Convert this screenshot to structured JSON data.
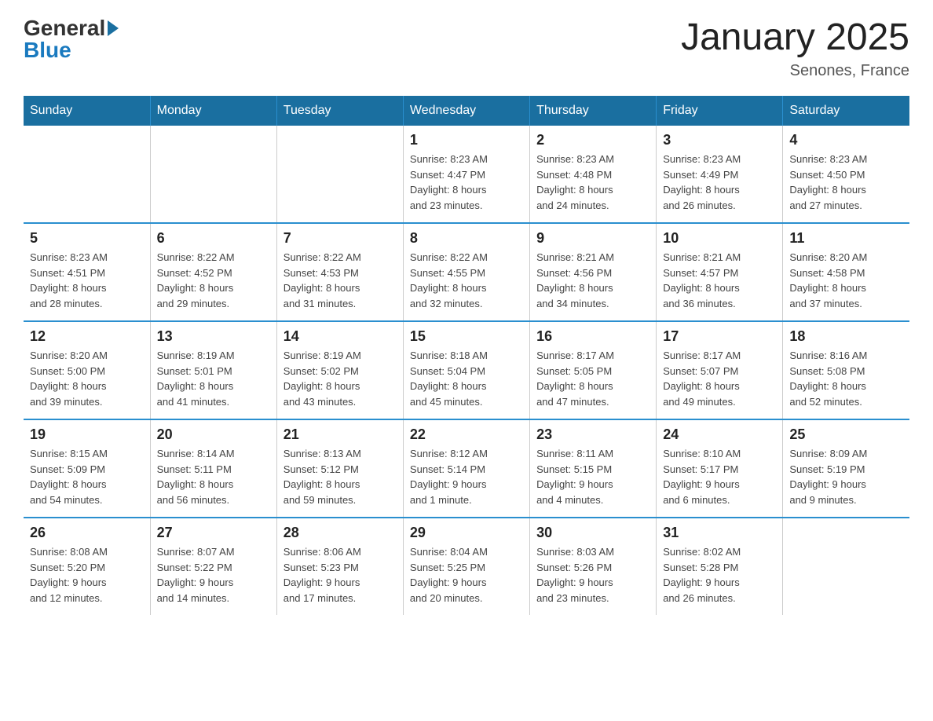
{
  "logo": {
    "general": "General",
    "blue": "Blue"
  },
  "title": "January 2025",
  "subtitle": "Senones, France",
  "weekdays": [
    "Sunday",
    "Monday",
    "Tuesday",
    "Wednesday",
    "Thursday",
    "Friday",
    "Saturday"
  ],
  "weeks": [
    [
      {
        "day": "",
        "info": ""
      },
      {
        "day": "",
        "info": ""
      },
      {
        "day": "",
        "info": ""
      },
      {
        "day": "1",
        "info": "Sunrise: 8:23 AM\nSunset: 4:47 PM\nDaylight: 8 hours\nand 23 minutes."
      },
      {
        "day": "2",
        "info": "Sunrise: 8:23 AM\nSunset: 4:48 PM\nDaylight: 8 hours\nand 24 minutes."
      },
      {
        "day": "3",
        "info": "Sunrise: 8:23 AM\nSunset: 4:49 PM\nDaylight: 8 hours\nand 26 minutes."
      },
      {
        "day": "4",
        "info": "Sunrise: 8:23 AM\nSunset: 4:50 PM\nDaylight: 8 hours\nand 27 minutes."
      }
    ],
    [
      {
        "day": "5",
        "info": "Sunrise: 8:23 AM\nSunset: 4:51 PM\nDaylight: 8 hours\nand 28 minutes."
      },
      {
        "day": "6",
        "info": "Sunrise: 8:22 AM\nSunset: 4:52 PM\nDaylight: 8 hours\nand 29 minutes."
      },
      {
        "day": "7",
        "info": "Sunrise: 8:22 AM\nSunset: 4:53 PM\nDaylight: 8 hours\nand 31 minutes."
      },
      {
        "day": "8",
        "info": "Sunrise: 8:22 AM\nSunset: 4:55 PM\nDaylight: 8 hours\nand 32 minutes."
      },
      {
        "day": "9",
        "info": "Sunrise: 8:21 AM\nSunset: 4:56 PM\nDaylight: 8 hours\nand 34 minutes."
      },
      {
        "day": "10",
        "info": "Sunrise: 8:21 AM\nSunset: 4:57 PM\nDaylight: 8 hours\nand 36 minutes."
      },
      {
        "day": "11",
        "info": "Sunrise: 8:20 AM\nSunset: 4:58 PM\nDaylight: 8 hours\nand 37 minutes."
      }
    ],
    [
      {
        "day": "12",
        "info": "Sunrise: 8:20 AM\nSunset: 5:00 PM\nDaylight: 8 hours\nand 39 minutes."
      },
      {
        "day": "13",
        "info": "Sunrise: 8:19 AM\nSunset: 5:01 PM\nDaylight: 8 hours\nand 41 minutes."
      },
      {
        "day": "14",
        "info": "Sunrise: 8:19 AM\nSunset: 5:02 PM\nDaylight: 8 hours\nand 43 minutes."
      },
      {
        "day": "15",
        "info": "Sunrise: 8:18 AM\nSunset: 5:04 PM\nDaylight: 8 hours\nand 45 minutes."
      },
      {
        "day": "16",
        "info": "Sunrise: 8:17 AM\nSunset: 5:05 PM\nDaylight: 8 hours\nand 47 minutes."
      },
      {
        "day": "17",
        "info": "Sunrise: 8:17 AM\nSunset: 5:07 PM\nDaylight: 8 hours\nand 49 minutes."
      },
      {
        "day": "18",
        "info": "Sunrise: 8:16 AM\nSunset: 5:08 PM\nDaylight: 8 hours\nand 52 minutes."
      }
    ],
    [
      {
        "day": "19",
        "info": "Sunrise: 8:15 AM\nSunset: 5:09 PM\nDaylight: 8 hours\nand 54 minutes."
      },
      {
        "day": "20",
        "info": "Sunrise: 8:14 AM\nSunset: 5:11 PM\nDaylight: 8 hours\nand 56 minutes."
      },
      {
        "day": "21",
        "info": "Sunrise: 8:13 AM\nSunset: 5:12 PM\nDaylight: 8 hours\nand 59 minutes."
      },
      {
        "day": "22",
        "info": "Sunrise: 8:12 AM\nSunset: 5:14 PM\nDaylight: 9 hours\nand 1 minute."
      },
      {
        "day": "23",
        "info": "Sunrise: 8:11 AM\nSunset: 5:15 PM\nDaylight: 9 hours\nand 4 minutes."
      },
      {
        "day": "24",
        "info": "Sunrise: 8:10 AM\nSunset: 5:17 PM\nDaylight: 9 hours\nand 6 minutes."
      },
      {
        "day": "25",
        "info": "Sunrise: 8:09 AM\nSunset: 5:19 PM\nDaylight: 9 hours\nand 9 minutes."
      }
    ],
    [
      {
        "day": "26",
        "info": "Sunrise: 8:08 AM\nSunset: 5:20 PM\nDaylight: 9 hours\nand 12 minutes."
      },
      {
        "day": "27",
        "info": "Sunrise: 8:07 AM\nSunset: 5:22 PM\nDaylight: 9 hours\nand 14 minutes."
      },
      {
        "day": "28",
        "info": "Sunrise: 8:06 AM\nSunset: 5:23 PM\nDaylight: 9 hours\nand 17 minutes."
      },
      {
        "day": "29",
        "info": "Sunrise: 8:04 AM\nSunset: 5:25 PM\nDaylight: 9 hours\nand 20 minutes."
      },
      {
        "day": "30",
        "info": "Sunrise: 8:03 AM\nSunset: 5:26 PM\nDaylight: 9 hours\nand 23 minutes."
      },
      {
        "day": "31",
        "info": "Sunrise: 8:02 AM\nSunset: 5:28 PM\nDaylight: 9 hours\nand 26 minutes."
      },
      {
        "day": "",
        "info": ""
      }
    ]
  ]
}
